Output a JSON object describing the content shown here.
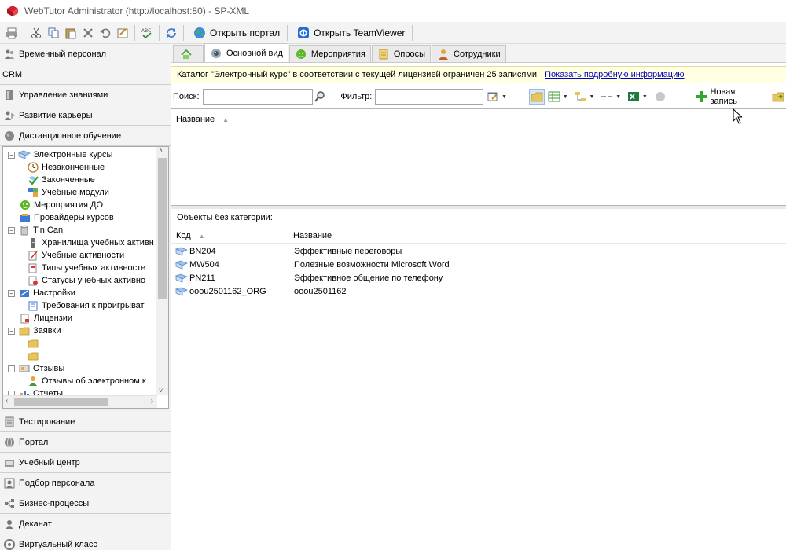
{
  "window": {
    "title": "WebTutor Administrator (http://localhost:80) - SP-XML"
  },
  "toolbar": {
    "open_portal_label": "Открыть портал",
    "open_teamviewer_label": "Открыть TeamViewer"
  },
  "sidebar": {
    "top_items": [
      {
        "label": "Временный персонал",
        "icon": "people-icon"
      },
      {
        "label": "CRM",
        "icon": ""
      },
      {
        "label": "Управление знаниями",
        "icon": "book-icon"
      },
      {
        "label": "Развитие карьеры",
        "icon": "career-icon"
      },
      {
        "label": "Дистанционное обучение",
        "icon": "globe-icon"
      }
    ],
    "tree": [
      {
        "label": "Электронные курсы",
        "expanded": true
      },
      {
        "label": "Незаконченные"
      },
      {
        "label": "Законченные"
      },
      {
        "label": "Учебные модули"
      },
      {
        "label": "Мероприятия ДО"
      },
      {
        "label": "Провайдеры курсов"
      },
      {
        "label": "Tin Can",
        "expanded": true
      },
      {
        "label": "Хранилища учебных активн"
      },
      {
        "label": "Учебные активности"
      },
      {
        "label": "Типы учебных активносте"
      },
      {
        "label": "Статусы учебных активно"
      },
      {
        "label": "Настройки",
        "expanded": true
      },
      {
        "label": "Требования к проигрыват"
      },
      {
        "label": "Лицензии"
      },
      {
        "label": "Заявки",
        "expanded": true
      },
      {
        "label": "Отзывы",
        "expanded": true
      },
      {
        "label": "Отзывы об электронном к"
      },
      {
        "label": "Отчеты",
        "expanded": true
      }
    ],
    "bottom_items": [
      {
        "label": "Тестирование",
        "icon": "test-icon"
      },
      {
        "label": "Портал",
        "icon": "portal-icon"
      },
      {
        "label": "Учебный центр",
        "icon": "training-center-icon"
      },
      {
        "label": "Подбор персонала",
        "icon": "recruiting-icon"
      },
      {
        "label": "Бизнес-процессы",
        "icon": "process-icon"
      },
      {
        "label": "Деканат",
        "icon": "dean-office-icon"
      },
      {
        "label": "Виртуальный класс",
        "icon": "virtual-class-icon"
      }
    ]
  },
  "tabs": [
    {
      "label": "",
      "icon": "home-icon"
    },
    {
      "label": "Основной вид",
      "icon": "eye-icon",
      "active": true
    },
    {
      "label": "Мероприятия",
      "icon": "event-icon"
    },
    {
      "label": "Опросы",
      "icon": "poll-icon"
    },
    {
      "label": "Сотрудники",
      "icon": "person-icon"
    }
  ],
  "infobar": {
    "message": "Каталог \"Электронный курс\" в соответствии с текущей лицензией ограничен 25 записями.",
    "link": "Показать подробную информацию"
  },
  "filterbar": {
    "search_label": "Поиск:",
    "search_value": "",
    "filter_label": "Фильтр:",
    "filter_value": "",
    "new_record_label": "Новая запись"
  },
  "upper_grid": {
    "column_name": "Название"
  },
  "lower_grid": {
    "section_title": "Объекты без категории:",
    "col_code": "Код",
    "col_name": "Название",
    "rows": [
      {
        "code": "BN204",
        "name": "Эффективные переговоры"
      },
      {
        "code": "MW504",
        "name": "Полезные возможности Microsoft Word"
      },
      {
        "code": "PN211",
        "name": "Эффективное общение по телефону"
      },
      {
        "code": "ooou2501162_ORG",
        "name": "ooou2501162"
      }
    ]
  }
}
